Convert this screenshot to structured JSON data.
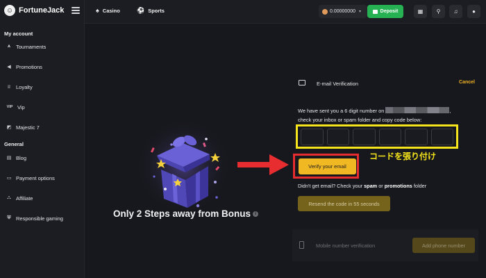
{
  "sidebar": {
    "brand": "FortuneJack",
    "sections": [
      {
        "title": "My account",
        "items": [
          {
            "label": "Tournaments",
            "icon": "trophy-icon",
            "glyph": "⩚"
          },
          {
            "label": "Promotions",
            "icon": "megaphone-icon",
            "glyph": "◀"
          },
          {
            "label": "Loyalty",
            "icon": "crown-icon",
            "glyph": "♕"
          },
          {
            "label": "Vip",
            "icon": "vip-icon",
            "glyph": "VIP"
          },
          {
            "label": "Majestic 7",
            "icon": "majestic-icon",
            "glyph": "◩"
          }
        ]
      },
      {
        "title": "General",
        "items": [
          {
            "label": "Blog",
            "icon": "blog-icon",
            "glyph": "▤"
          },
          {
            "label": "Payment options",
            "icon": "payment-icon",
            "glyph": "▭"
          },
          {
            "label": "Affiliate",
            "icon": "affiliate-icon",
            "glyph": "⛬"
          },
          {
            "label": "Responsible gaming",
            "icon": "shield-icon",
            "glyph": "⛨"
          }
        ]
      }
    ]
  },
  "topbar": {
    "casino": "Casino",
    "sports": "Sports",
    "balance": "0.00000000",
    "deposit": "Deposit"
  },
  "promo": {
    "title": "Only 2 Steps away from Bonus"
  },
  "verification": {
    "title": "E-mail Verification",
    "cancel": "Cancel",
    "message_before": "We have sent you a 6 digit number on",
    "message_after": ",",
    "message_line2": "check your inbox or spam folder and copy code below:",
    "code_boxes": [
      "",
      "",
      "",
      "",
      "",
      ""
    ],
    "paste_note": "コードを張り付け",
    "verify_button": "Verify your email",
    "didnt_get_prefix": "Didn't get email? Check your",
    "spam": "spam",
    "or": "or",
    "promotions": "promotions",
    "folder": "folder",
    "resend_button": "Resend the code in 55 seconds"
  },
  "mobile": {
    "label": "Mobile number verification",
    "add_button": "Add phone number"
  },
  "colors": {
    "accent_yellow": "#f0b823",
    "deposit_green": "#26b152",
    "highlight_yellow": "#f5e51a",
    "highlight_red": "#e72d30"
  }
}
